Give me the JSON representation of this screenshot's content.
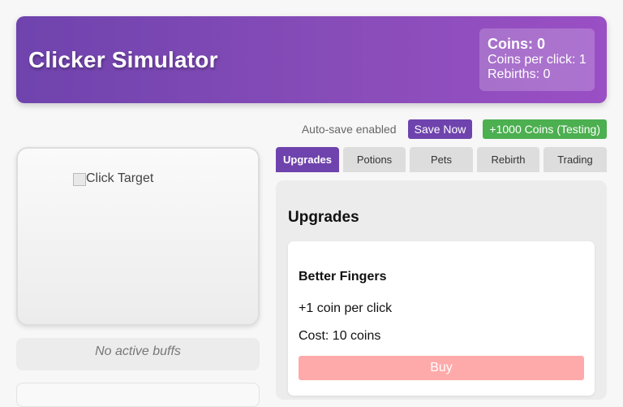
{
  "app": {
    "title": "Clicker Simulator"
  },
  "stats": {
    "coins": "Coins: 0",
    "coins_per_click": "Coins per click: 1",
    "rebirths": "Rebirths: 0"
  },
  "save_bar": {
    "autosave_label": "Auto-save enabled",
    "save_button": "Save Now",
    "testing_button": "+1000 Coins (Testing)"
  },
  "click_area": {
    "image_alt": "Click Target"
  },
  "buffs": {
    "status": "No active buffs"
  },
  "tabs": [
    {
      "label": "Upgrades",
      "active": true
    },
    {
      "label": "Potions",
      "active": false
    },
    {
      "label": "Pets",
      "active": false
    },
    {
      "label": "Rebirth",
      "active": false
    },
    {
      "label": "Trading",
      "active": false
    }
  ],
  "upgrades_panel": {
    "title": "Upgrades",
    "items": [
      {
        "name": "Better Fingers",
        "description": "+1 coin per click",
        "cost": "Cost: 10 coins",
        "buy_label": "Buy"
      }
    ]
  },
  "colors": {
    "accent": "#6f43ad",
    "success": "#4caf50",
    "buy_disabled": "#ffaaaa"
  }
}
